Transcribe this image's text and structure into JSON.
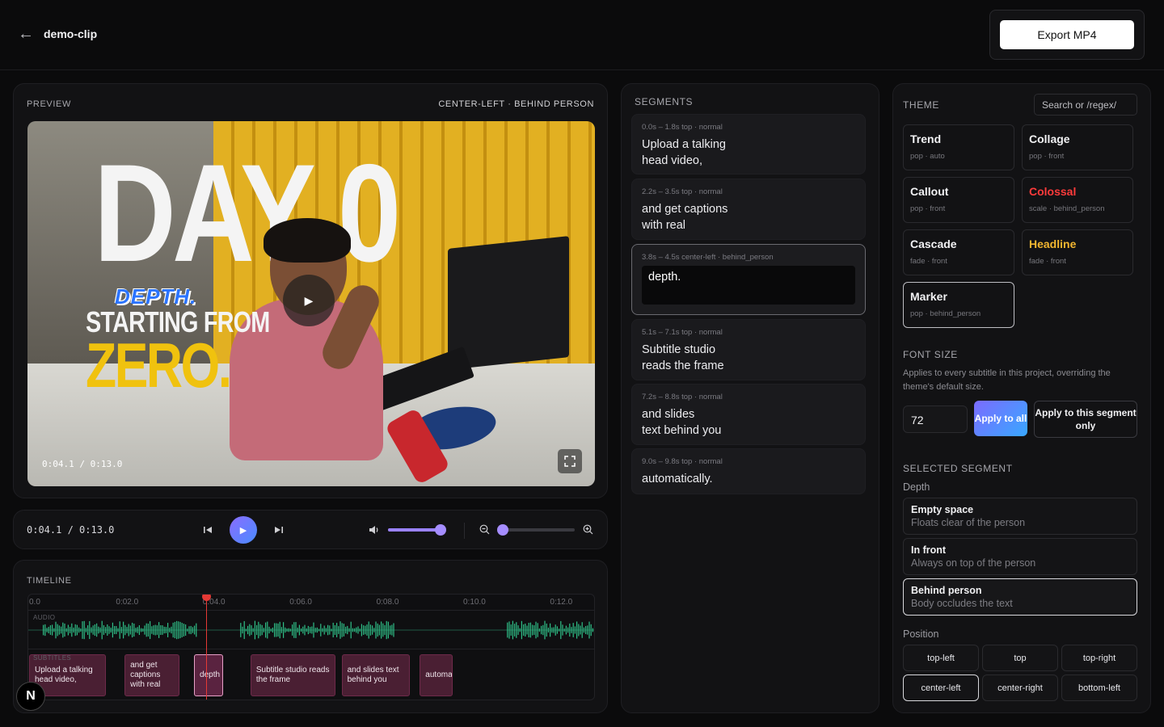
{
  "header": {
    "back_arrow": "←",
    "title": "demo-clip",
    "export_label": "Export MP4"
  },
  "preview": {
    "label": "PREVIEW",
    "placement": "CENTER-LEFT · BEHIND PERSON",
    "overlay_time": "0:04.1 / 0:13.0",
    "big_text": "DAY 0",
    "caption_depth": "DEPTH.",
    "caption_start": "STARTING FROM",
    "caption_zero": "ZERO."
  },
  "transport": {
    "time": "0:04.1 / 0:13.0",
    "volume": 0.9,
    "zoom": 0.05
  },
  "timeline": {
    "label": "TIMELINE",
    "ticks": [
      "0.0",
      "0:02.0",
      "0:04.0",
      "0:06.0",
      "0:08.0",
      "0:10.0",
      "0:12.0"
    ],
    "audio_label": "AUDIO",
    "subtitles_label": "SUBTITLES",
    "clips": [
      {
        "text": "Upload a talking head video,",
        "start": 0.0,
        "end": 1.8
      },
      {
        "text": "and get captions with real",
        "start": 2.2,
        "end": 3.5
      },
      {
        "text": "depth",
        "start": 3.8,
        "end": 4.5,
        "active": true
      },
      {
        "text": "Subtitle studio reads the frame",
        "start": 5.1,
        "end": 7.1
      },
      {
        "text": "and slides text behind you",
        "start": 7.2,
        "end": 8.8
      },
      {
        "text": "automa",
        "start": 9.0,
        "end": 9.8
      }
    ],
    "playhead": 4.1,
    "duration": 13.0
  },
  "segments": {
    "label": "SEGMENTS",
    "items": [
      {
        "meta": "0.0s – 1.8s   top · normal",
        "text": "Upload a talking\nhead video,"
      },
      {
        "meta": "2.2s – 3.5s   top · normal",
        "text": "and get captions\nwith real"
      },
      {
        "meta": "3.8s – 4.5s   center-left · behind_person",
        "text": "depth.",
        "active": true
      },
      {
        "meta": "5.1s – 7.1s   top · normal",
        "text": "Subtitle studio\nreads the frame"
      },
      {
        "meta": "7.2s – 8.8s   top · normal",
        "text": "and slides\ntext behind you"
      },
      {
        "meta": "9.0s – 9.8s   top · normal",
        "text": "automatically."
      }
    ]
  },
  "theme": {
    "label": "THEME",
    "search_placeholder": "Search or /regex/",
    "cards": [
      {
        "name": "Trend",
        "sub": "pop · auto",
        "color": "#f1f1f3"
      },
      {
        "name": "Collage",
        "sub": "pop · front",
        "color": "#f1f1f3"
      },
      {
        "name": "Callout",
        "sub": "pop · front",
        "color": "#f1f1f3"
      },
      {
        "name": "Colossal",
        "sub": "scale · behind_person",
        "color": "#ff3b3b"
      },
      {
        "name": "Cascade",
        "sub": "fade · front",
        "color": "#f1f1f3"
      },
      {
        "name": "Headline",
        "sub": "fade · front",
        "color": "#f2b630"
      },
      {
        "name": "Marker",
        "sub": "pop · behind_person",
        "color": "#f1f1f3",
        "selected": true
      }
    ]
  },
  "font_size": {
    "label": "FONT SIZE",
    "desc": "Applies to every subtitle in this project, overriding the theme's default size.",
    "value": "72",
    "apply_all": "Apply to all",
    "apply_segment": "Apply to this segment only"
  },
  "selected_segment": {
    "label": "SELECTED SEGMENT",
    "depth_label": "Depth",
    "depth_options": [
      {
        "title": "Empty space",
        "desc": "Floats clear of the person"
      },
      {
        "title": "In front",
        "desc": "Always on top of the person"
      },
      {
        "title": "Behind person",
        "desc": "Body occludes the text",
        "selected": true
      }
    ],
    "position_label": "Position",
    "positions": [
      "top-left",
      "top",
      "top-right",
      "center-left",
      "center-right",
      "bottom-left"
    ],
    "selected_position": "center-left"
  },
  "badge": "N"
}
